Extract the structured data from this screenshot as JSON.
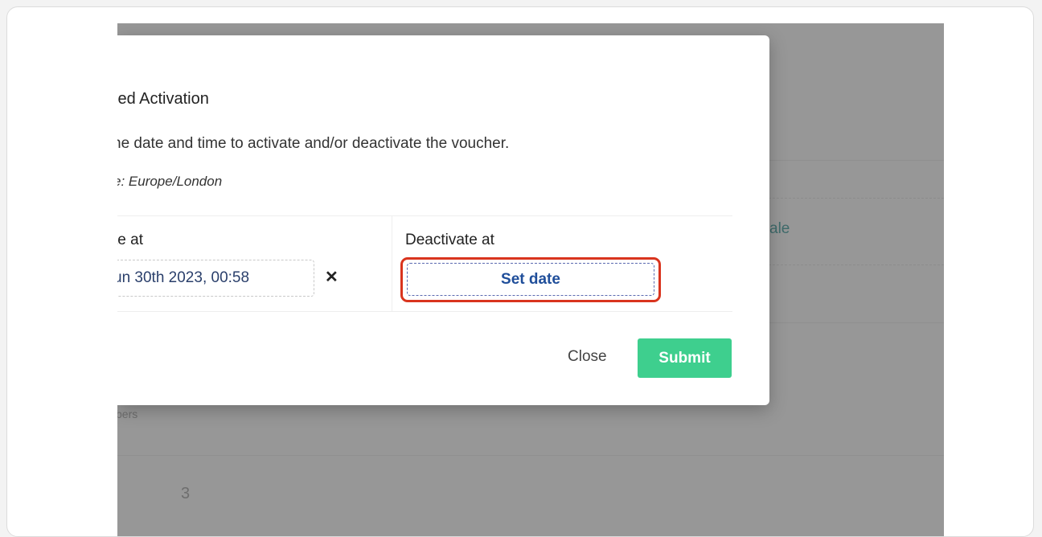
{
  "modal": {
    "title": "led Activation",
    "description": "ne date and time to activate and/or deactivate the voucher.",
    "timezone": "e: Europe/London",
    "activate": {
      "header": "te at",
      "value": "un 30th 2023, 00:58",
      "clear_icon": "✕"
    },
    "deactivate": {
      "header": "Deactivate at",
      "button_label": "Set date"
    },
    "close_label": "Close",
    "submit_label": "Submit"
  },
  "background": {
    "link_fragment": "ale",
    "text_fragment": "bers",
    "count": "3"
  },
  "colors": {
    "accent_submit": "#3ecf8e",
    "highlight": "#d9341e",
    "link": "#1f4e9a",
    "overlay": "#979797"
  }
}
